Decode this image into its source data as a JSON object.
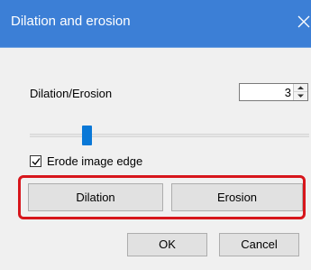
{
  "window": {
    "title": "Dilation and erosion",
    "titlebar_color": "#3c7fd6"
  },
  "controls": {
    "iterations": {
      "label": "Dilation/Erosion",
      "value": "3"
    },
    "slider": {
      "min": 1,
      "max": 10,
      "value": 3
    },
    "erode_edge": {
      "label": "Erode image edge",
      "checked": true
    }
  },
  "actions": {
    "dilation_label": "Dilation",
    "erosion_label": "Erosion",
    "highlight_color": "#d7161c"
  },
  "footer": {
    "ok_label": "OK",
    "cancel_label": "Cancel"
  },
  "icons": {
    "close": "close-icon",
    "spin_up": "chevron-up-icon",
    "spin_down": "chevron-down-icon",
    "check": "checkmark-icon"
  }
}
